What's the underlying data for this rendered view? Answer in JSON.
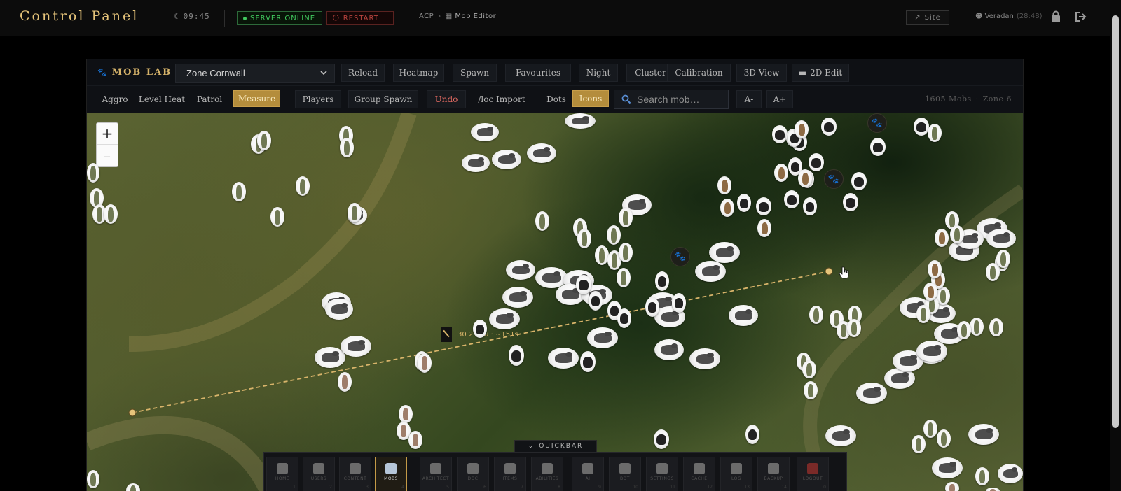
{
  "header": {
    "brand": "Control Panel",
    "clock": "09:45",
    "server_status": "SERVER ONLINE",
    "restart_label": "RESTART",
    "breadcrumb": {
      "root": "ACP",
      "current": "Mob Editor"
    },
    "site_label": "Site",
    "user_name": "Veradan",
    "user_id": "(28:48)"
  },
  "mob_lab": {
    "title": "MOB LAB",
    "zone": "Zone Cornwall",
    "toolbar_top": [
      "Reload",
      "Heatmap",
      "Spawn",
      "Favourites",
      "Night",
      "Cluster",
      "Calibration",
      "3D View"
    ],
    "edit_2d_label": "2D Edit",
    "toolbar_bottom": {
      "aggro": "Aggro",
      "level_heat": "Level Heat",
      "patrol": "Patrol",
      "measure": "Measure",
      "players": "Players",
      "group_spawn": "Group Spawn",
      "undo": "Undo",
      "loc_import": "/loc Import",
      "dots": "Dots",
      "icons": "Icons",
      "font_smaller": "A-",
      "font_larger": "A+"
    },
    "search_placeholder": "Search mob…",
    "mob_count": "1605 Mobs",
    "zone_number": "Zone 6",
    "measure_readout": "30 293 u · ~151s"
  },
  "colors": {
    "accent_gold": "#b48d3c",
    "online_green": "#41c95e",
    "restart_red": "#b8433e",
    "spawn_orange": "#e0701c",
    "measure_line": "#d8b46a"
  },
  "quickbar": {
    "toggle_label": "QUICKBAR",
    "items": [
      {
        "label": "HOME",
        "key": "1",
        "icon": "dashboard-icon"
      },
      {
        "label": "USERS",
        "key": "2",
        "icon": "users-icon"
      },
      {
        "label": "CONTENT",
        "key": "3",
        "icon": "edit-icon"
      },
      {
        "label": "MOBS",
        "key": "4",
        "icon": "map-icon",
        "active": true
      },
      {
        "label": "ARCHITECT",
        "key": "5",
        "icon": "compass-icon"
      },
      {
        "label": "DOC",
        "key": "6",
        "icon": "scroll-icon"
      },
      {
        "label": "ITEMS",
        "key": "7",
        "icon": "shield-icon"
      },
      {
        "label": "ABILITIES",
        "key": "8",
        "icon": "bolt-icon"
      },
      {
        "label": "AI",
        "key": "9",
        "icon": "bulb-icon"
      },
      {
        "label": "BOT",
        "key": "10",
        "icon": "robot-icon"
      },
      {
        "label": "SETTINGS",
        "key": "11",
        "icon": "gear-icon"
      },
      {
        "label": "CACHE",
        "key": "12",
        "icon": "database-icon"
      },
      {
        "label": "LOG",
        "key": "13",
        "icon": "history-icon"
      },
      {
        "label": "BACKUP",
        "key": "14",
        "icon": "archive-icon"
      },
      {
        "label": "LOGOUT",
        "key": "0",
        "icon": "logout-icon"
      }
    ]
  }
}
